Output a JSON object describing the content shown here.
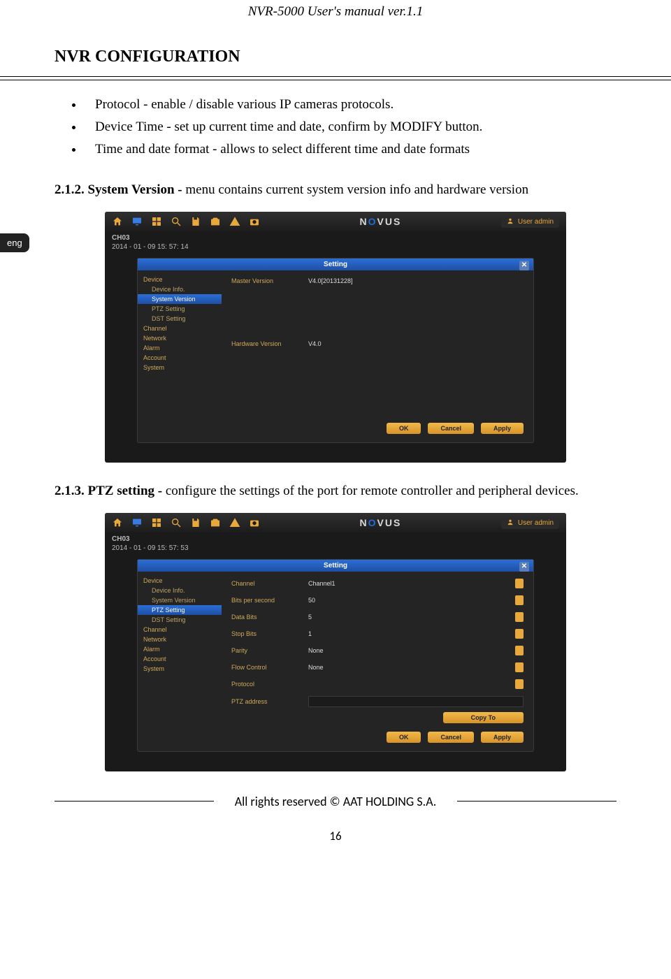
{
  "header": "NVR-5000 User's manual ver.1.1",
  "section_title": "NVR CONFIGURATION",
  "bullets": [
    "Protocol - enable / disable various IP cameras protocols.",
    "Device Time - set up current time and date, confirm by MODIFY button.",
    "Time and date format - allows to select different time and date formats"
  ],
  "sub1": {
    "num": "2.1.2. System Version - ",
    "text": "menu contains current system version info and hardware version"
  },
  "sub2": {
    "num": "2.1.3. PTZ setting - ",
    "text": "configure the settings of the port for remote controller and peripheral devices."
  },
  "lang_tab": "eng",
  "brand": {
    "pre": "N",
    "accent": "O",
    "post": "VUS"
  },
  "user_label": "User admin",
  "shot1": {
    "channel": "CH03",
    "timestamp": "2014 - 01 - 09  15: 57: 14",
    "dialog_title": "Setting",
    "sidebar": [
      {
        "label": "Device",
        "sub": false,
        "active": false
      },
      {
        "label": "Device Info.",
        "sub": true,
        "active": false
      },
      {
        "label": "System Version",
        "sub": true,
        "active": true
      },
      {
        "label": "PTZ Setting",
        "sub": true,
        "active": false
      },
      {
        "label": "DST Setting",
        "sub": true,
        "active": false
      },
      {
        "label": "Channel",
        "sub": false,
        "active": false
      },
      {
        "label": "Network",
        "sub": false,
        "active": false
      },
      {
        "label": "Alarm",
        "sub": false,
        "active": false
      },
      {
        "label": "Account",
        "sub": false,
        "active": false
      },
      {
        "label": "System",
        "sub": false,
        "active": false
      }
    ],
    "rows": [
      {
        "label": "Master Version",
        "value": "V4.0[20131228]"
      }
    ],
    "hw": {
      "label": "Hardware Version",
      "value": "V4.0"
    },
    "buttons": [
      "OK",
      "Cancel",
      "Apply"
    ]
  },
  "shot2": {
    "channel": "CH03",
    "timestamp": "2014 - 01 - 09  15: 57: 53",
    "dialog_title": "Setting",
    "sidebar": [
      {
        "label": "Device",
        "sub": false,
        "active": false
      },
      {
        "label": "Device Info.",
        "sub": true,
        "active": false
      },
      {
        "label": "System Version",
        "sub": true,
        "active": false
      },
      {
        "label": "PTZ Setting",
        "sub": true,
        "active": true
      },
      {
        "label": "DST Setting",
        "sub": true,
        "active": false
      },
      {
        "label": "Channel",
        "sub": false,
        "active": false
      },
      {
        "label": "Network",
        "sub": false,
        "active": false
      },
      {
        "label": "Alarm",
        "sub": false,
        "active": false
      },
      {
        "label": "Account",
        "sub": false,
        "active": false
      },
      {
        "label": "System",
        "sub": false,
        "active": false
      }
    ],
    "rows": [
      {
        "label": "Channel",
        "value": "Channel1",
        "drop": true
      },
      {
        "label": "Bits per second",
        "value": "50",
        "drop": true
      },
      {
        "label": "Data Bits",
        "value": "5",
        "drop": true
      },
      {
        "label": "Stop Bits",
        "value": "1",
        "drop": true
      },
      {
        "label": "Parity",
        "value": "None",
        "drop": true
      },
      {
        "label": "Flow Control",
        "value": "None",
        "drop": true
      },
      {
        "label": "Protocol",
        "value": "",
        "drop": true
      },
      {
        "label": "PTZ address",
        "value": "",
        "field": true
      }
    ],
    "copy": "Copy To",
    "buttons": [
      "OK",
      "Cancel",
      "Apply"
    ]
  },
  "footer": "All rights reserved © AAT HOLDING S.A.",
  "page_num": "16"
}
